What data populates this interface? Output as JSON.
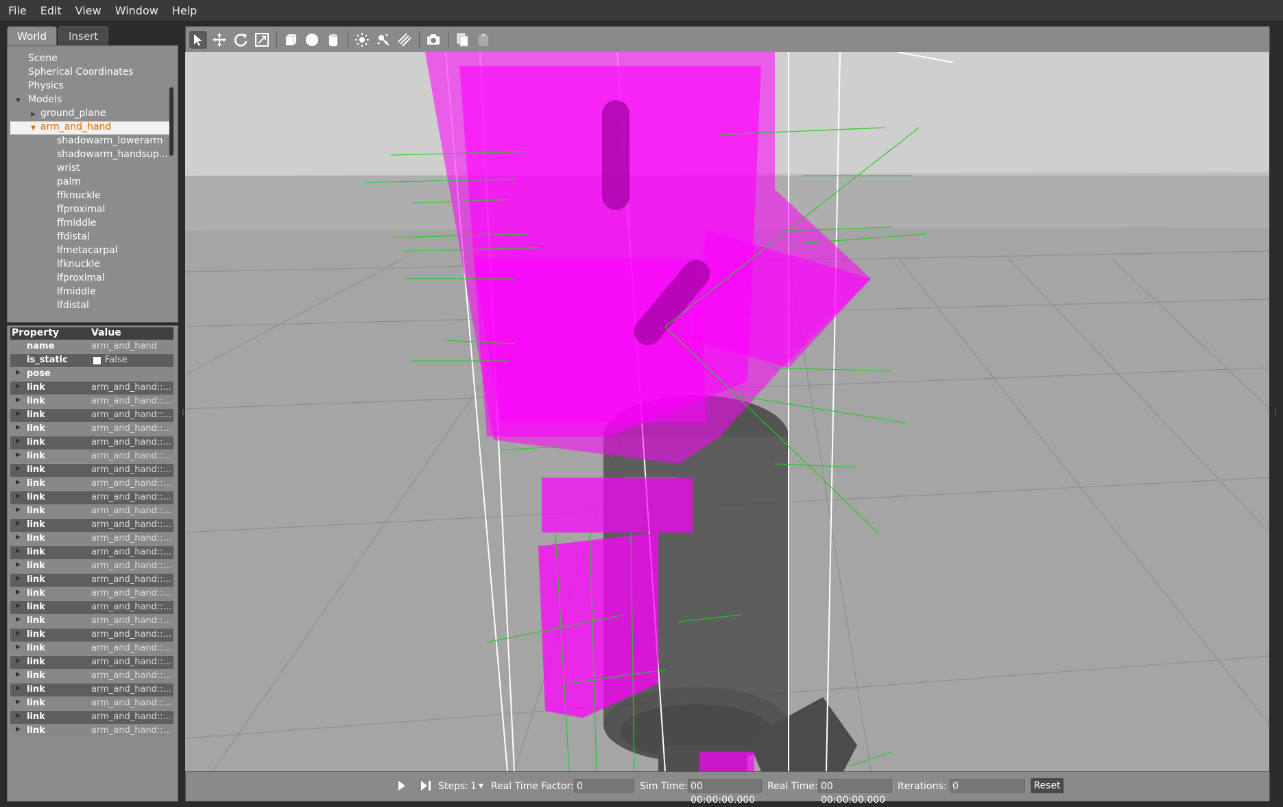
{
  "menubar": {
    "items": [
      "File",
      "Edit",
      "View",
      "Window",
      "Help"
    ]
  },
  "tabs": {
    "world": "World",
    "insert": "Insert"
  },
  "tree": {
    "top_items": [
      "Scene",
      "Spherical Coordinates",
      "Physics",
      "Models"
    ],
    "models": [
      "ground_plane",
      "arm_and_hand"
    ],
    "children": [
      "shadowarm_lowerarm",
      "shadowarm_handsup...",
      "wrist",
      "palm",
      "ffknuckle",
      "ffproximal",
      "ffmiddle",
      "ffdistal",
      "lfmetacarpal",
      "lfknuckle",
      "lfproximal",
      "lfmiddle",
      "lfdistal"
    ]
  },
  "properties": {
    "header_property": "Property",
    "header_value": "Value",
    "name_key": "name",
    "name_value": "arm_and_hand",
    "is_static_key": "is_static",
    "is_static_value": "False",
    "pose_key": "pose",
    "link_key": "link",
    "link_value": "arm_and_hand::..."
  },
  "toolbar": {
    "tools": [
      "select-arrow-icon",
      "translate-icon",
      "rotate-icon",
      "scale-icon",
      "box-icon",
      "sphere-icon",
      "cylinder-icon",
      "point-light-icon",
      "spot-light-icon",
      "directional-light-icon",
      "screenshot-icon",
      "copy-icon",
      "paste-icon"
    ]
  },
  "bottombar": {
    "steps_label": "Steps:",
    "steps_value": "1",
    "rtf_label": "Real Time Factor:",
    "rtf_value": "0",
    "sim_time_label": "Sim Time:",
    "sim_time_value": "00 00:00:00.000",
    "real_time_label": "Real Time:",
    "real_time_value": "00 00:00:00.000",
    "iterations_label": "Iterations:",
    "iterations_value": "0",
    "reset_label": "Reset"
  },
  "colors": {
    "selected_text": "#e06a00",
    "magenta": "#ff00ff",
    "grid_green": "#22cc22"
  }
}
